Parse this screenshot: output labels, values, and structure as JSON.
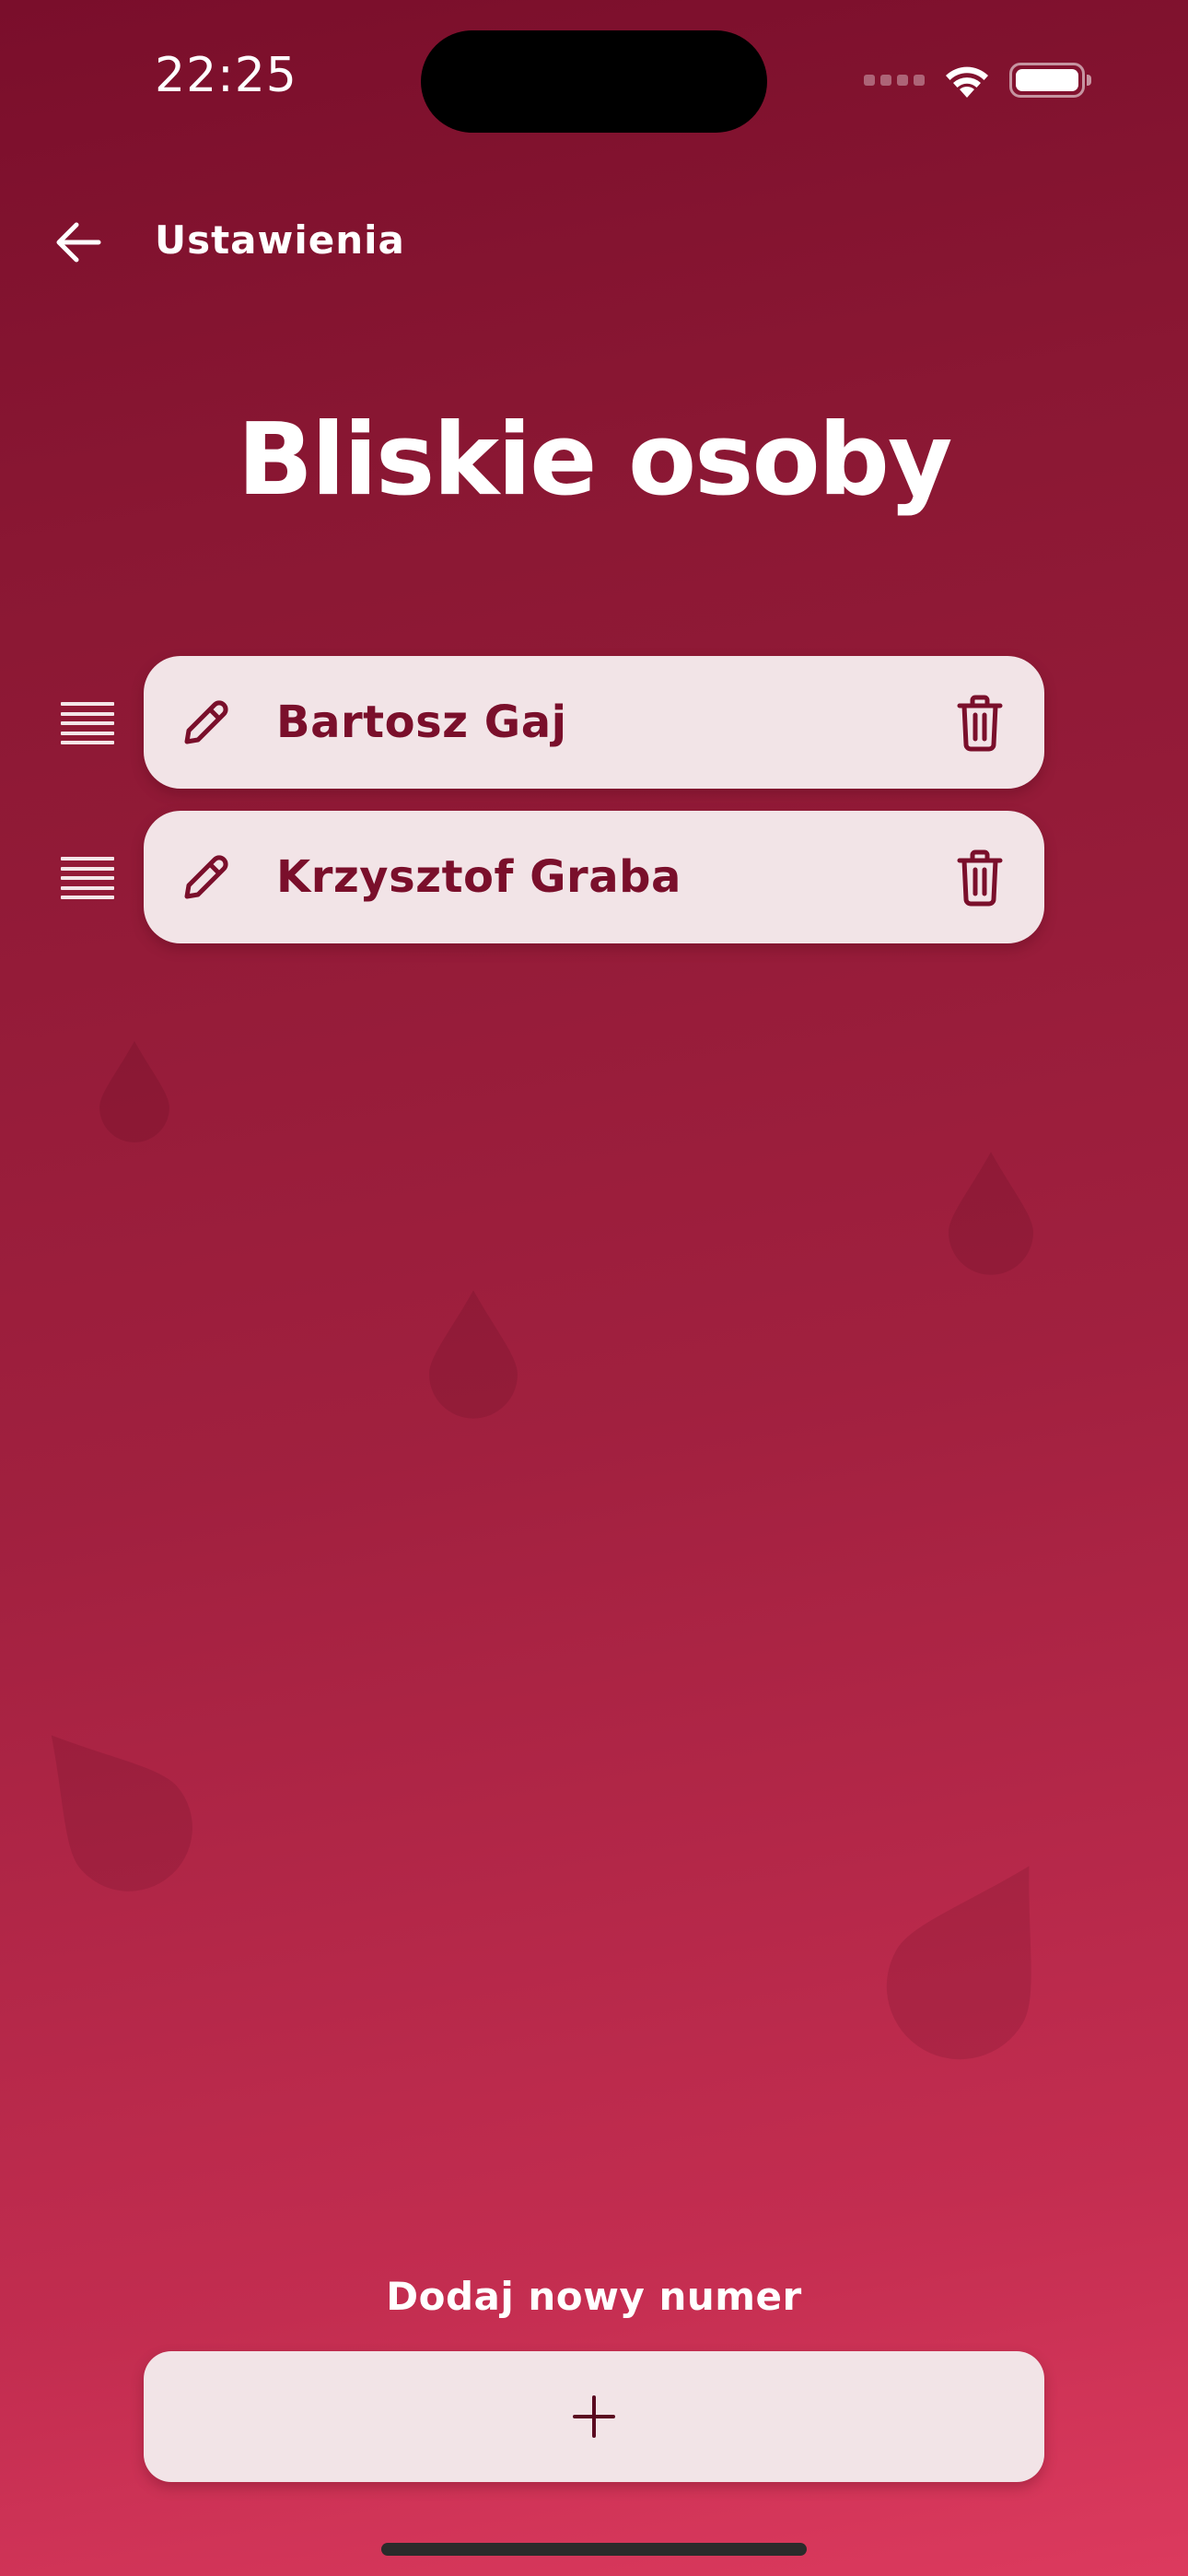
{
  "status_bar": {
    "time": "22:25"
  },
  "nav": {
    "back_icon": "arrow-left-icon",
    "title": "Ustawienia"
  },
  "page": {
    "title": "Bliskie osoby"
  },
  "contacts": [
    {
      "name": "Bartosz Gaj"
    },
    {
      "name": "Krzysztof Graba"
    }
  ],
  "add": {
    "label": "Dodaj nowy numer",
    "icon": "plus-icon"
  },
  "colors": {
    "background_top": "#7a0e2b",
    "background_bottom": "#dc3a5e",
    "card": "#f2e4e7",
    "accent": "#7a0f2b"
  }
}
